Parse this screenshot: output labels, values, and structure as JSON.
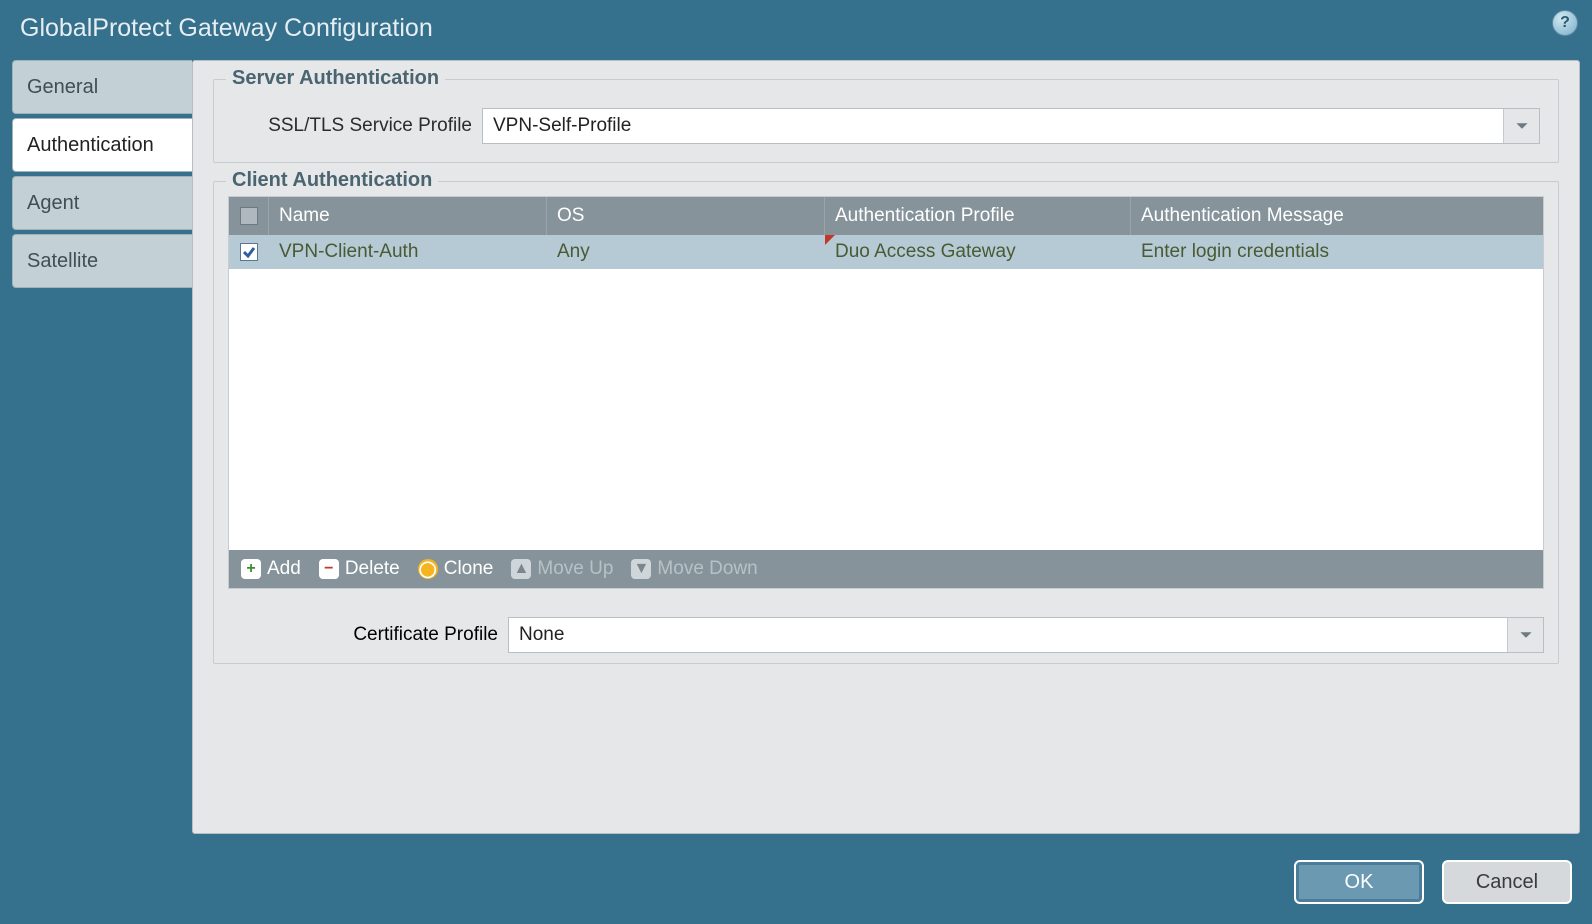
{
  "title": "GlobalProtect Gateway Configuration",
  "help_tooltip": "?",
  "tabs": {
    "general": "General",
    "authentication": "Authentication",
    "agent": "Agent",
    "satellite": "Satellite"
  },
  "server_auth": {
    "legend": "Server Authentication",
    "ssl_label": "SSL/TLS Service Profile",
    "ssl_value": "VPN-Self-Profile"
  },
  "client_auth": {
    "legend": "Client Authentication",
    "columns": {
      "name": "Name",
      "os": "OS",
      "auth_profile": "Authentication Profile",
      "auth_message": "Authentication Message"
    },
    "rows": [
      {
        "checked": true,
        "name": "VPN-Client-Auth",
        "os": "Any",
        "auth_profile": "Duo Access Gateway",
        "auth_message": "Enter login credentials",
        "dirty": true
      }
    ],
    "toolbar": {
      "add": "Add",
      "delete": "Delete",
      "clone": "Clone",
      "move_up": "Move Up",
      "move_down": "Move Down"
    }
  },
  "cert_profile": {
    "label": "Certificate Profile",
    "value": "None"
  },
  "buttons": {
    "ok": "OK",
    "cancel": "Cancel"
  }
}
